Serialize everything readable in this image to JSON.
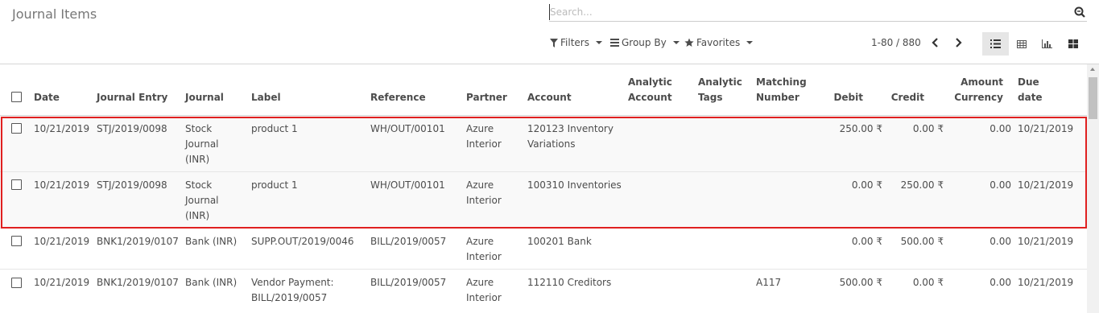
{
  "page": {
    "title": "Journal Items"
  },
  "search": {
    "placeholder": "Search..."
  },
  "toolbar": {
    "filters": "Filters",
    "group_by": "Group By",
    "favorites": "Favorites"
  },
  "pager": {
    "text": "1-80 / 880"
  },
  "views": [
    {
      "name": "list-view",
      "icon": "list-icon",
      "active": true
    },
    {
      "name": "pivot-view",
      "icon": "table-icon",
      "active": false
    },
    {
      "name": "graph-view",
      "icon": "bar-chart-icon",
      "active": false
    },
    {
      "name": "kanban-view",
      "icon": "grid-icon",
      "active": false
    }
  ],
  "columns": {
    "date": "Date",
    "journal_entry": "Journal Entry",
    "journal": "Journal",
    "label": "Label",
    "reference": "Reference",
    "partner": "Partner",
    "account": "Account",
    "analytic_account": [
      "Analytic",
      "Account"
    ],
    "analytic_tags": [
      "Analytic",
      "Tags"
    ],
    "matching_number": [
      "Matching",
      "Number"
    ],
    "debit": "Debit",
    "credit": "Credit",
    "amount_currency": [
      "Amount",
      "Currency"
    ],
    "due_date": [
      "Due",
      "date"
    ]
  },
  "rows": [
    {
      "date": "10/21/2019",
      "entry": "STJ/2019/0098",
      "journal": [
        "Stock",
        "Journal",
        "(INR)"
      ],
      "label": [
        "product 1"
      ],
      "reference": "WH/OUT/00101",
      "partner": [
        "Azure",
        "Interior"
      ],
      "account": [
        "120123 Inventory",
        "Variations"
      ],
      "matching": "",
      "debit": "250.00 ₹",
      "credit": "0.00 ₹",
      "amount_currency": "0.00",
      "due_date": "10/21/2019",
      "highlighted": true
    },
    {
      "date": "10/21/2019",
      "entry": "STJ/2019/0098",
      "journal": [
        "Stock",
        "Journal",
        "(INR)"
      ],
      "label": [
        "product 1"
      ],
      "reference": "WH/OUT/00101",
      "partner": [
        "Azure",
        "Interior"
      ],
      "account": [
        "100310 Inventories"
      ],
      "matching": "",
      "debit": "0.00 ₹",
      "credit": "250.00 ₹",
      "amount_currency": "0.00",
      "due_date": "10/21/2019",
      "highlighted": true
    },
    {
      "date": "10/21/2019",
      "entry": "BNK1/2019/0107",
      "journal": [
        "Bank (INR)"
      ],
      "label": [
        "SUPP.OUT/2019/0046"
      ],
      "reference": "BILL/2019/0057",
      "partner": [
        "Azure",
        "Interior"
      ],
      "account": [
        "100201 Bank"
      ],
      "matching": "",
      "debit": "0.00 ₹",
      "credit": "500.00 ₹",
      "amount_currency": "0.00",
      "due_date": "10/21/2019",
      "highlighted": false
    },
    {
      "date": "10/21/2019",
      "entry": "BNK1/2019/0107",
      "journal": [
        "Bank (INR)"
      ],
      "label": [
        "Vendor Payment:",
        "BILL/2019/0057"
      ],
      "reference": "BILL/2019/0057",
      "partner": [
        "Azure",
        "Interior"
      ],
      "account": [
        "112110 Creditors"
      ],
      "matching": "A117",
      "debit": "500.00 ₹",
      "credit": "0.00 ₹",
      "amount_currency": "0.00",
      "due_date": "10/21/2019",
      "highlighted": false
    }
  ]
}
